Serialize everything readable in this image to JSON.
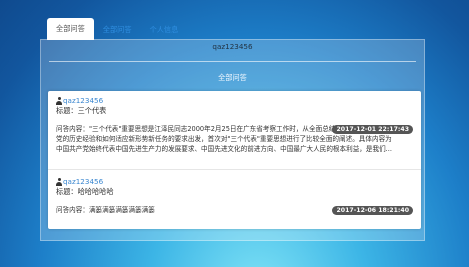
{
  "tabs": [
    {
      "label": "全部问答",
      "active": true
    },
    {
      "label": "全部问答",
      "active": false
    },
    {
      "label": "个人信息",
      "active": false
    }
  ],
  "username": "qaz123456",
  "section_title": "全部问答",
  "questions": [
    {
      "author": "qaz123456",
      "title": "标题：三个代表",
      "content_lines": [
        "问答内容：\"三个代表\"重要思想是江泽民同志2000年2月25日在广东省考察工作时，从全面总结",
        "党的历史经验和如何适应新形势新任务的要求出发，首次对\"三个代表\"重要思想进行了比较全面的阐述。具体内容为",
        "中国共产党始终代表中国先进生产力的发展要求、中国先进文化的前进方向、中国最广大人民的根本利益，是我们..."
      ],
      "timestamp": "2017-12-01 22:17:43"
    },
    {
      "author": "qaz123456",
      "title": "标题：哈哈哈哈哈",
      "content_lines": [
        "问答内容：满篓满篓满篓满篓满篓"
      ],
      "timestamp": "2017-12-06 18:21:40"
    }
  ]
}
